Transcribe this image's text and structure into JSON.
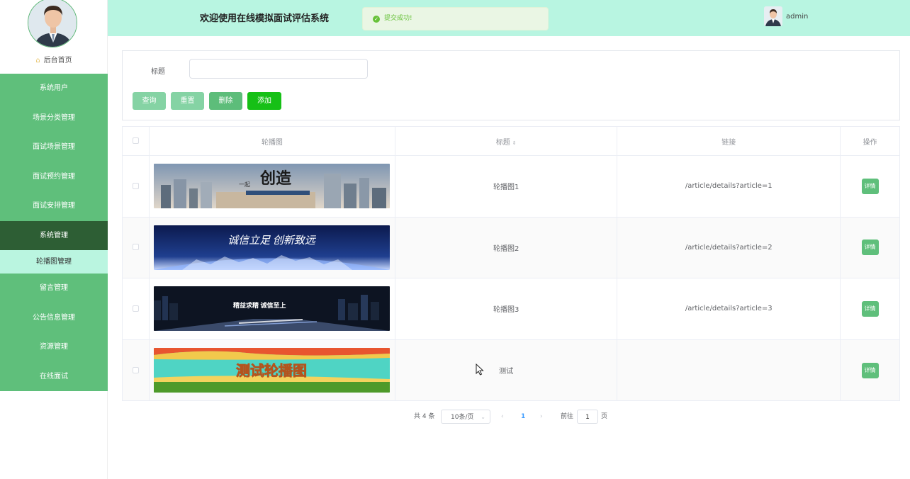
{
  "sidebar": {
    "home": "后台首页",
    "items": [
      {
        "label": "系统用户"
      },
      {
        "label": "场景分类管理"
      },
      {
        "label": "面试场景管理"
      },
      {
        "label": "面试预约管理"
      },
      {
        "label": "面试安排管理"
      },
      {
        "label": "系统管理"
      },
      {
        "label": "轮播图管理"
      },
      {
        "label": "留言管理"
      },
      {
        "label": "公告信息管理"
      },
      {
        "label": "资源管理"
      },
      {
        "label": "在线面试"
      }
    ]
  },
  "header": {
    "title": "欢迎使用在线模拟面试评估系统",
    "toast": "提交成功!",
    "username": "admin"
  },
  "search": {
    "label": "标题",
    "value": "",
    "buttons": {
      "query": "查询",
      "reset": "重置",
      "delete": "删除",
      "add": "添加"
    }
  },
  "table": {
    "columns": {
      "image": "轮播图",
      "title": "标题",
      "link": "链接",
      "action": "操作"
    },
    "rows": [
      {
        "title": "轮播图1",
        "link": "/article/details?article=1",
        "action": "详情",
        "banner_text": "创造",
        "banner_sub": "一起"
      },
      {
        "title": "轮播图2",
        "link": "/article/details?article=2",
        "action": "详情",
        "banner_text": "诚信立足 创新致远"
      },
      {
        "title": "轮播图3",
        "link": "/article/details?article=3",
        "action": "详情",
        "banner_text": "精益求精 诚信至上"
      },
      {
        "title": "测试",
        "link": "",
        "action": "详情",
        "banner_text": "测试轮播图"
      }
    ]
  },
  "pagination": {
    "total": "共 4 条",
    "page_size": "10条/页",
    "current_page": "1",
    "goto_label": "前往",
    "goto_value": "1",
    "page_suffix": "页"
  },
  "colors": {
    "sidebar_green": "#5fbf7b",
    "sidebar_active": "#2d5e34",
    "header_bg": "#b8f5e1",
    "add_button": "#16c016"
  }
}
